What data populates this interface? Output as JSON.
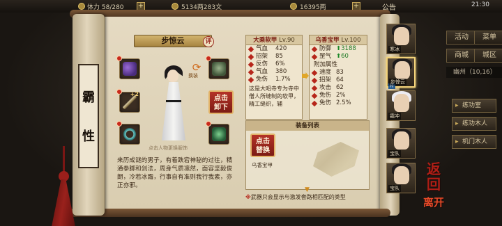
{
  "topbar": {
    "res_stamina": "体力 58/280",
    "res_money": "5134两283文",
    "res_gold": "16395两",
    "notice": "公告",
    "clock": "21:30"
  },
  "side_tab": {
    "chars": [
      "霸",
      "性"
    ]
  },
  "character": {
    "name": "步惊云",
    "eval_label": "评",
    "swap_label": "换装",
    "figure_hint": "点击人物更换服饰",
    "description": "来历成谜的男子，有着跌宕神秘的过往，精通拳脚和剑法，周身气质凛然，面容坚毅俊朗，冷若冰霜，行事自有准则我行我素，亦正亦邪。"
  },
  "slots": {
    "shoulder_plus": "",
    "sword_plus": "+2",
    "unequip_label": "点击\n卸下"
  },
  "current_equip": {
    "name": "大乘软甲",
    "level": "Lv.90",
    "stats": [
      {
        "label": "气血",
        "value": "420"
      },
      {
        "label": "招架",
        "value": "85"
      },
      {
        "label": "反伤",
        "value": "6%"
      },
      {
        "label": "气血",
        "value": "380"
      },
      {
        "label": "免伤",
        "value": "1.7%"
      }
    ],
    "flavor": "这是大昭寺专为寺中僧人所缝制的软甲，精工缝织，辅"
  },
  "new_equip": {
    "name": "乌香宝甲",
    "level": "Lv.100",
    "stats": [
      {
        "label": "防御",
        "value": "3188",
        "up": true
      },
      {
        "label": "罡气",
        "value": "60",
        "up": true
      }
    ],
    "subtitle": "附加属性",
    "extra": [
      {
        "label": "速度",
        "value": "83"
      },
      {
        "label": "招架",
        "value": "64"
      },
      {
        "label": "攻击",
        "value": "62"
      },
      {
        "label": "免伤",
        "value": "2%"
      },
      {
        "label": "免伤",
        "value": "2.5%"
      }
    ]
  },
  "equip_list": {
    "title": "装备列表",
    "item_button": "点击\n替换",
    "item_name": "乌香宝甲",
    "hint_warn": "※",
    "hint_text": "武器只会显示与激发套路相匹配的类型"
  },
  "right_rail": {
    "buttons": [
      "活动",
      "菜单",
      "商城",
      "城区"
    ],
    "info": "幽州（10,16）",
    "items": [
      "练功室",
      "练功木人",
      "机门木人"
    ]
  },
  "portraits": [
    {
      "tag": "寒冰",
      "mark": "",
      "selected": false
    },
    {
      "tag": "步惊云",
      "mark": "将",
      "selected": true
    },
    {
      "tag": "霜冲",
      "mark": "",
      "selected": false
    },
    {
      "tag": "宝队",
      "mark": "",
      "selected": false
    },
    {
      "tag": "宝队",
      "mark": "",
      "selected": false
    }
  ],
  "exit": {
    "top": "返回",
    "bottom": "离开"
  }
}
